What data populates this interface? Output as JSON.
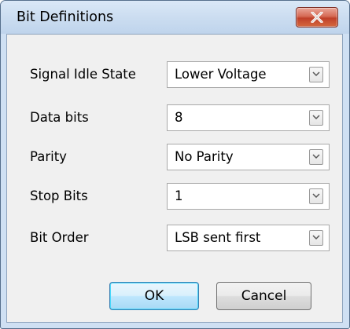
{
  "window": {
    "title": "Bit Definitions"
  },
  "icons": {
    "close": "close-icon",
    "dropdown": "chevron-down-icon"
  },
  "colors": {
    "close_button": "#c8452f",
    "default_button_border": "#3c7fb1",
    "title_bar": "#cadcf0"
  },
  "fields": [
    {
      "label": "Signal Idle State",
      "value": "Lower Voltage"
    },
    {
      "label": "Data bits",
      "value": "8"
    },
    {
      "label": "Parity",
      "value": "No Parity"
    },
    {
      "label": "Stop Bits",
      "value": "1"
    },
    {
      "label": "Bit Order",
      "value": "LSB sent first"
    }
  ],
  "buttons": {
    "ok": "OK",
    "cancel": "Cancel"
  }
}
